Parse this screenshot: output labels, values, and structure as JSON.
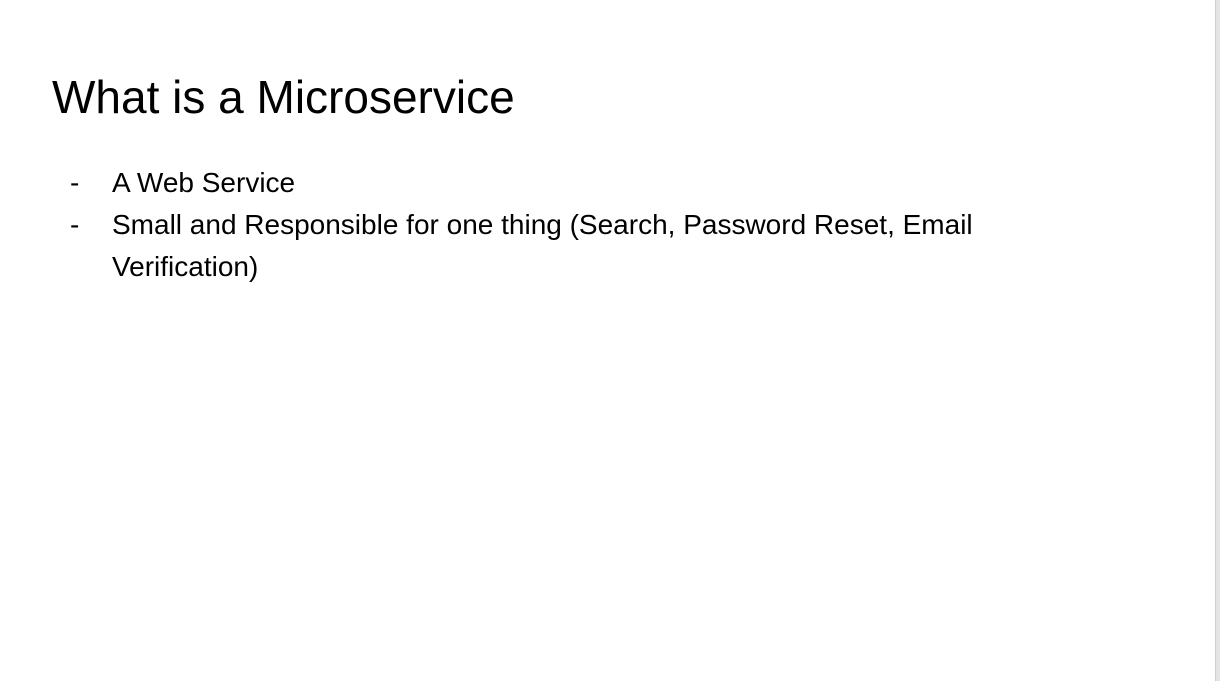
{
  "slide": {
    "title": "What is a Microservice",
    "bullet_marker": "-",
    "bullets": [
      "A Web Service",
      "Small and Responsible for one thing (Search, Password Reset, Email Verification)"
    ]
  }
}
